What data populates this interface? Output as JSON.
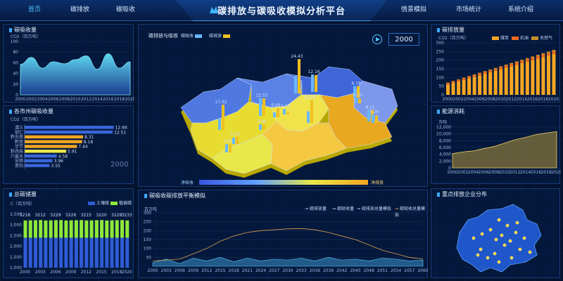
{
  "nav": {
    "left": [
      "首页",
      "碳排放",
      "碳吸收"
    ],
    "right": [
      "情景模拟",
      "市场统计",
      "系统介绍"
    ],
    "title": "碳排放与碳吸收模拟分析平台"
  },
  "panels": {
    "absorb": {
      "title": "碳吸收量",
      "unit": "CO2（百万吨）"
    },
    "city": {
      "title": "各市州碳吸收量",
      "unit": "CO2（百万吨）",
      "watermark": "2000"
    },
    "total": {
      "title": "总碳储量",
      "unit": "C（百万吨）",
      "legend": [
        "土壤碳",
        "植被碳"
      ]
    },
    "map": {
      "title": "碳排放与吸收",
      "legend": [
        "碳吸收",
        "碳排放"
      ],
      "year": "2000",
      "scale_left": "净吸收",
      "scale_right": "净排放"
    },
    "balance": {
      "title": "碳吸收碳排放平衡模拟",
      "unit": "百万吨",
      "legend": [
        "碳排放量",
        "碳吸收量",
        "碳排放总量模拟",
        "碳吸收总量模拟"
      ]
    },
    "emission": {
      "title": "碳排放量",
      "unit": "CO2（百万吨）",
      "legend": [
        "煤炭",
        "石油",
        "天然气"
      ]
    },
    "energy": {
      "title": "能源消耗",
      "unit": "万吨"
    },
    "enterprise": {
      "title": "重点排放企业分布"
    }
  },
  "chart_data": [
    {
      "type": "area",
      "title": "碳吸收量",
      "ylabel": "CO2（百万吨）",
      "x": [
        "2000",
        "2002",
        "2004",
        "2006",
        "2008",
        "2010",
        "2012",
        "2014",
        "2016",
        "2018",
        "2020"
      ],
      "ylim": [
        0,
        100
      ],
      "values": [
        57,
        70,
        50,
        62,
        58,
        66,
        73,
        48,
        77,
        50,
        62
      ]
    },
    {
      "type": "bar",
      "title": "各市州碳吸收量",
      "categories": [
        "遵义",
        "铜仁",
        "黔东南",
        "黔南",
        "毕节",
        "黔西南",
        "六盘水",
        "安顺",
        "贵阳"
      ],
      "values": [
        12.66,
        12.51,
        8.31,
        8.18,
        7.44,
        5.91,
        4.58,
        3.96,
        3.55
      ]
    },
    {
      "type": "bar",
      "title": "总碳储量",
      "ylabel": "C（百万吨）",
      "categories": [
        "2000",
        "2003",
        "2006",
        "2009",
        "2012",
        "2015",
        "2018",
        "2020"
      ],
      "ylim": [
        1000,
        3500
      ],
      "series": [
        {
          "name": "土壤碳",
          "values": [
            2400,
            2400,
            2400,
            2400,
            2400,
            2400,
            2400,
            2400
          ]
        },
        {
          "name": "植被碳",
          "values": [
            818,
            812,
            829,
            826,
            815,
            820,
            828,
            833
          ]
        }
      ],
      "labels": [
        "3218",
        "3212",
        "3229",
        "3226",
        "3215",
        "3220",
        "3228",
        "3233"
      ]
    },
    {
      "type": "line",
      "title": "碳吸收碳排放平衡模拟",
      "ylabel": "百万吨",
      "x": [
        "2000",
        "2003",
        "2006",
        "2009",
        "2012",
        "2015",
        "2018",
        "2021",
        "2024",
        "2027",
        "2030",
        "2033",
        "2036",
        "2039",
        "2042",
        "2045",
        "2048",
        "2051",
        "2054",
        "2057",
        "2060"
      ],
      "ylim": [
        0,
        300
      ],
      "series": [
        {
          "name": "碳排放量",
          "values": [
            30,
            35,
            40,
            70,
            100,
            140,
            170,
            190,
            200,
            205,
            210,
            212,
            205,
            190,
            170,
            150,
            120,
            90,
            70,
            50,
            40
          ]
        },
        {
          "name": "碳吸收量",
          "values": [
            20,
            40,
            15,
            45,
            30,
            50,
            25,
            45,
            30,
            40,
            35,
            45,
            30,
            50,
            35,
            40,
            30,
            45,
            40,
            30,
            35
          ]
        }
      ]
    },
    {
      "type": "bar",
      "title": "碳排放量",
      "ylabel": "CO2（百万吨）",
      "categories": [
        "2000",
        "2002",
        "2004",
        "2006",
        "2008",
        "2010",
        "2012",
        "2014",
        "2016",
        "2018",
        "2020"
      ],
      "ylim": [
        0,
        300
      ],
      "series": [
        {
          "name": "煤炭",
          "values": [
            60,
            75,
            95,
            120,
            150,
            175,
            200,
            215,
            225,
            230,
            235
          ]
        },
        {
          "name": "石油",
          "values": [
            8,
            9,
            10,
            11,
            12,
            13,
            14,
            15,
            15,
            16,
            16
          ]
        },
        {
          "name": "天然气",
          "values": [
            3,
            3,
            4,
            4,
            5,
            5,
            6,
            6,
            7,
            7,
            8
          ]
        }
      ]
    },
    {
      "type": "area",
      "title": "能源消耗",
      "ylabel": "万吨",
      "x": [
        "2000",
        "2002",
        "2004",
        "2006",
        "2008",
        "2010",
        "2012",
        "2014",
        "2016",
        "2018",
        "2020"
      ],
      "ylim": [
        0,
        12000
      ],
      "values": [
        4200,
        4700,
        5000,
        5700,
        6300,
        7300,
        8300,
        9000,
        9800,
        10300,
        10700
      ]
    }
  ],
  "map_cities": [
    {
      "name": "毕节",
      "emission": 17.92,
      "absorb": 8.18
    },
    {
      "name": "六盘水",
      "emission": 5.16,
      "absorb": 4.58
    },
    {
      "name": "遵义",
      "emission": 12.53,
      "absorb": 12.66
    },
    {
      "name": "贵阳",
      "emission": 6.69,
      "absorb": 3.55
    },
    {
      "name": "安顺",
      "emission": 1.55,
      "absorb": 3.96
    },
    {
      "name": "铜仁",
      "emission": 12.16,
      "absorb": 12.51
    },
    {
      "name": "黔东南",
      "emission": 16.1,
      "absorb": 8.31
    },
    {
      "name": "黔南",
      "emission": 3.96,
      "absorb": 8.18
    },
    {
      "name": "黔西南",
      "emission": 5.65,
      "absorb": 5.91
    }
  ],
  "map_labels": [
    "17.92",
    "12.53",
    "5.16",
    "6.69",
    "3.96",
    "1.55",
    "24.43",
    "12.16",
    "16.10",
    "8.18",
    "3.13",
    "8.11",
    "5.26",
    "5.65"
  ]
}
